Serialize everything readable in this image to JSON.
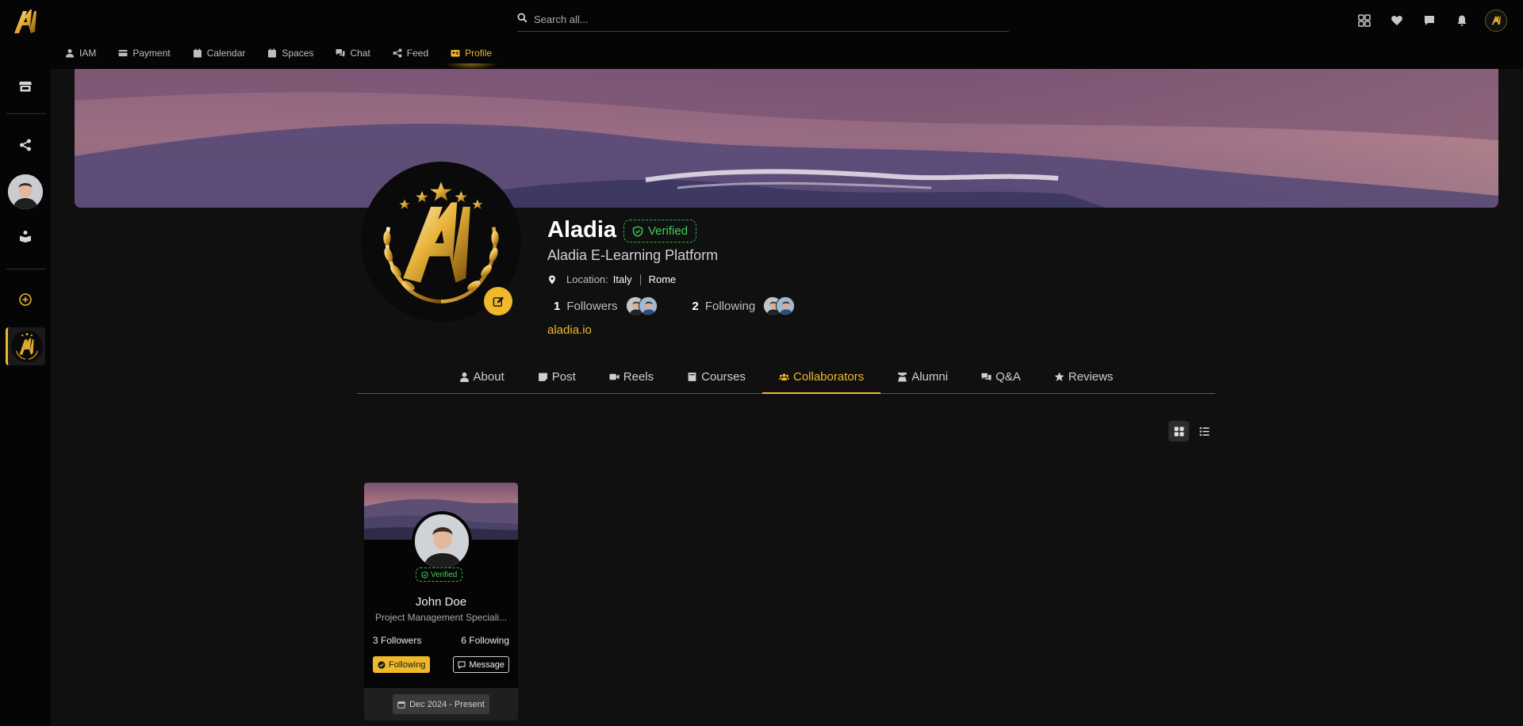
{
  "app": {
    "search_placeholder": "Search all...",
    "accent_color": "#f0b92b",
    "verified_color": "#3fcf5c"
  },
  "top_nav": {
    "tabs": [
      {
        "label": "IAM",
        "icon": "user-icon"
      },
      {
        "label": "Payment",
        "icon": "credit-card-icon"
      },
      {
        "label": "Calendar",
        "icon": "calendar-icon"
      },
      {
        "label": "Spaces",
        "icon": "spaces-icon"
      },
      {
        "label": "Chat",
        "icon": "chat-icon"
      },
      {
        "label": "Feed",
        "icon": "share-icon"
      },
      {
        "label": "Profile",
        "icon": "id-card-icon"
      }
    ],
    "active_tab": "Profile",
    "right_icons": [
      "apps-grid-icon",
      "heart-icon",
      "messages-icon",
      "bell-icon",
      "account-avatar"
    ]
  },
  "sidebar": {
    "icons": [
      "store-icon",
      "share-icon",
      "user-avatar",
      "book-reader-icon",
      "add-circle-icon",
      "organization-logo"
    ]
  },
  "profile": {
    "name": "Aladia",
    "verified_label": "Verified",
    "subtitle": "Aladia E-Learning Platform",
    "location_label": "Location:",
    "country": "Italy",
    "city": "Rome",
    "followers_count": "1",
    "followers_label": "Followers",
    "following_count": "2",
    "following_label": "Following",
    "website": "aladia.io"
  },
  "profile_tabs": [
    {
      "label": "About",
      "icon": "user-icon"
    },
    {
      "label": "Post",
      "icon": "post-icon"
    },
    {
      "label": "Reels",
      "icon": "video-icon"
    },
    {
      "label": "Courses",
      "icon": "book-icon"
    },
    {
      "label": "Collaborators",
      "icon": "users-icon"
    },
    {
      "label": "Alumni",
      "icon": "graduate-icon"
    },
    {
      "label": "Q&A",
      "icon": "comments-icon"
    },
    {
      "label": "Reviews",
      "icon": "star-icon"
    }
  ],
  "active_profile_tab": "Collaborators",
  "view_mode": "grid",
  "collaborators": [
    {
      "name": "John Doe",
      "role": "Project Management Speciali...",
      "verified_label": "Verified",
      "followers": "3 Followers",
      "following": "6 Following",
      "following_button": "Following",
      "message_button": "Message",
      "period": "Dec 2024 - Present"
    }
  ]
}
